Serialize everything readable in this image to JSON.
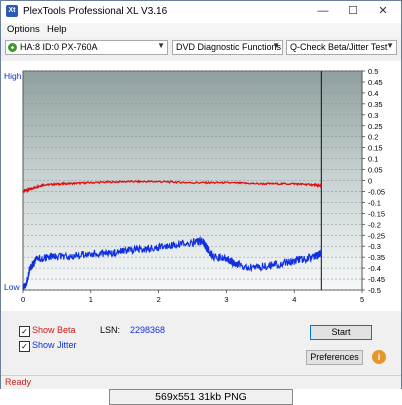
{
  "window": {
    "title": "PlexTools Professional XL V3.16",
    "minimize": "—",
    "maximize": "☐",
    "close": "✕"
  },
  "menu": {
    "items": [
      "Options",
      "Help"
    ]
  },
  "toolbar": {
    "drive": "HA:8 ID:0  PX-760A",
    "function": "DVD Diagnostic Functions",
    "test": "Q-Check Beta/Jitter Test"
  },
  "chart_data": {
    "type": "line",
    "left_axis_labels": {
      "top": "High",
      "bottom": "Low"
    },
    "x_ticks": [
      "0",
      "1",
      "2",
      "3",
      "4",
      "5"
    ],
    "xlim": [
      0,
      5
    ],
    "y_right_ticks": [
      "0.5",
      "0.45",
      "0.4",
      "0.35",
      "0.3",
      "0.25",
      "0.2",
      "0.15",
      "0.1",
      "0.05",
      "0",
      "-0.05",
      "-0.1",
      "-0.15",
      "-0.2",
      "-0.25",
      "-0.3",
      "-0.35",
      "-0.4",
      "-0.45",
      "-0.5"
    ],
    "ylim": [
      -0.5,
      0.5
    ],
    "end_marker_x": 4.4,
    "series": [
      {
        "color": "#e01010",
        "x": [
          0.0,
          0.1,
          0.3,
          0.6,
          1.0,
          1.5,
          2.0,
          2.5,
          3.0,
          3.5,
          4.0,
          4.3,
          4.4
        ],
        "y": [
          -0.05,
          -0.04,
          -0.02,
          -0.015,
          -0.01,
          -0.005,
          -0.005,
          -0.01,
          -0.01,
          -0.015,
          -0.015,
          -0.02,
          -0.025
        ]
      },
      {
        "color": "#1030e0",
        "x": [
          0.0,
          0.05,
          0.1,
          0.2,
          0.4,
          0.7,
          1.0,
          1.3,
          1.6,
          1.9,
          2.2,
          2.5,
          2.65,
          2.7,
          2.8,
          3.0,
          3.1,
          3.3,
          3.6,
          3.9,
          4.1,
          4.3,
          4.4
        ],
        "y": [
          -0.49,
          -0.47,
          -0.4,
          -0.36,
          -0.35,
          -0.345,
          -0.335,
          -0.33,
          -0.32,
          -0.31,
          -0.295,
          -0.285,
          -0.275,
          -0.3,
          -0.35,
          -0.355,
          -0.375,
          -0.4,
          -0.39,
          -0.375,
          -0.36,
          -0.35,
          -0.33
        ]
      }
    ]
  },
  "options": {
    "show_beta": {
      "label": "Show Beta",
      "checked": true,
      "color": "#d01818"
    },
    "show_jitter": {
      "label": "Show Jitter",
      "checked": true,
      "color": "#1030e0"
    }
  },
  "lsn": {
    "label": "LSN:",
    "value": "2298368"
  },
  "buttons": {
    "start": "Start",
    "preferences": "Preferences",
    "info": "i"
  },
  "status": "Ready",
  "caption": "569x551  31kb  PNG"
}
